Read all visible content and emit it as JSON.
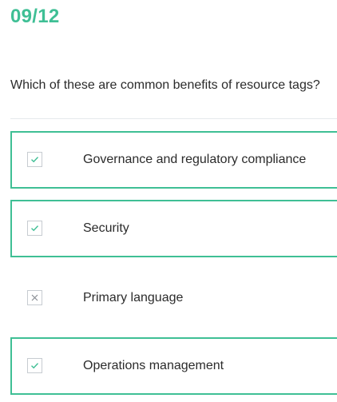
{
  "progress": {
    "counter": "09/12"
  },
  "question": {
    "text": "Which of these are common benefits of resource tags?"
  },
  "colors": {
    "accent": "#3fbf95",
    "text": "#2b2b2b",
    "box_border": "#c7ccd1",
    "cross": "#8a8f94"
  },
  "options": [
    {
      "label": "Governance and regulatory compliance",
      "state": "checked",
      "icon": "check-icon"
    },
    {
      "label": "Security",
      "state": "checked",
      "icon": "check-icon"
    },
    {
      "label": "Primary language",
      "state": "crossed",
      "icon": "cross-icon"
    },
    {
      "label": "Operations management",
      "state": "checked",
      "icon": "check-icon"
    }
  ]
}
